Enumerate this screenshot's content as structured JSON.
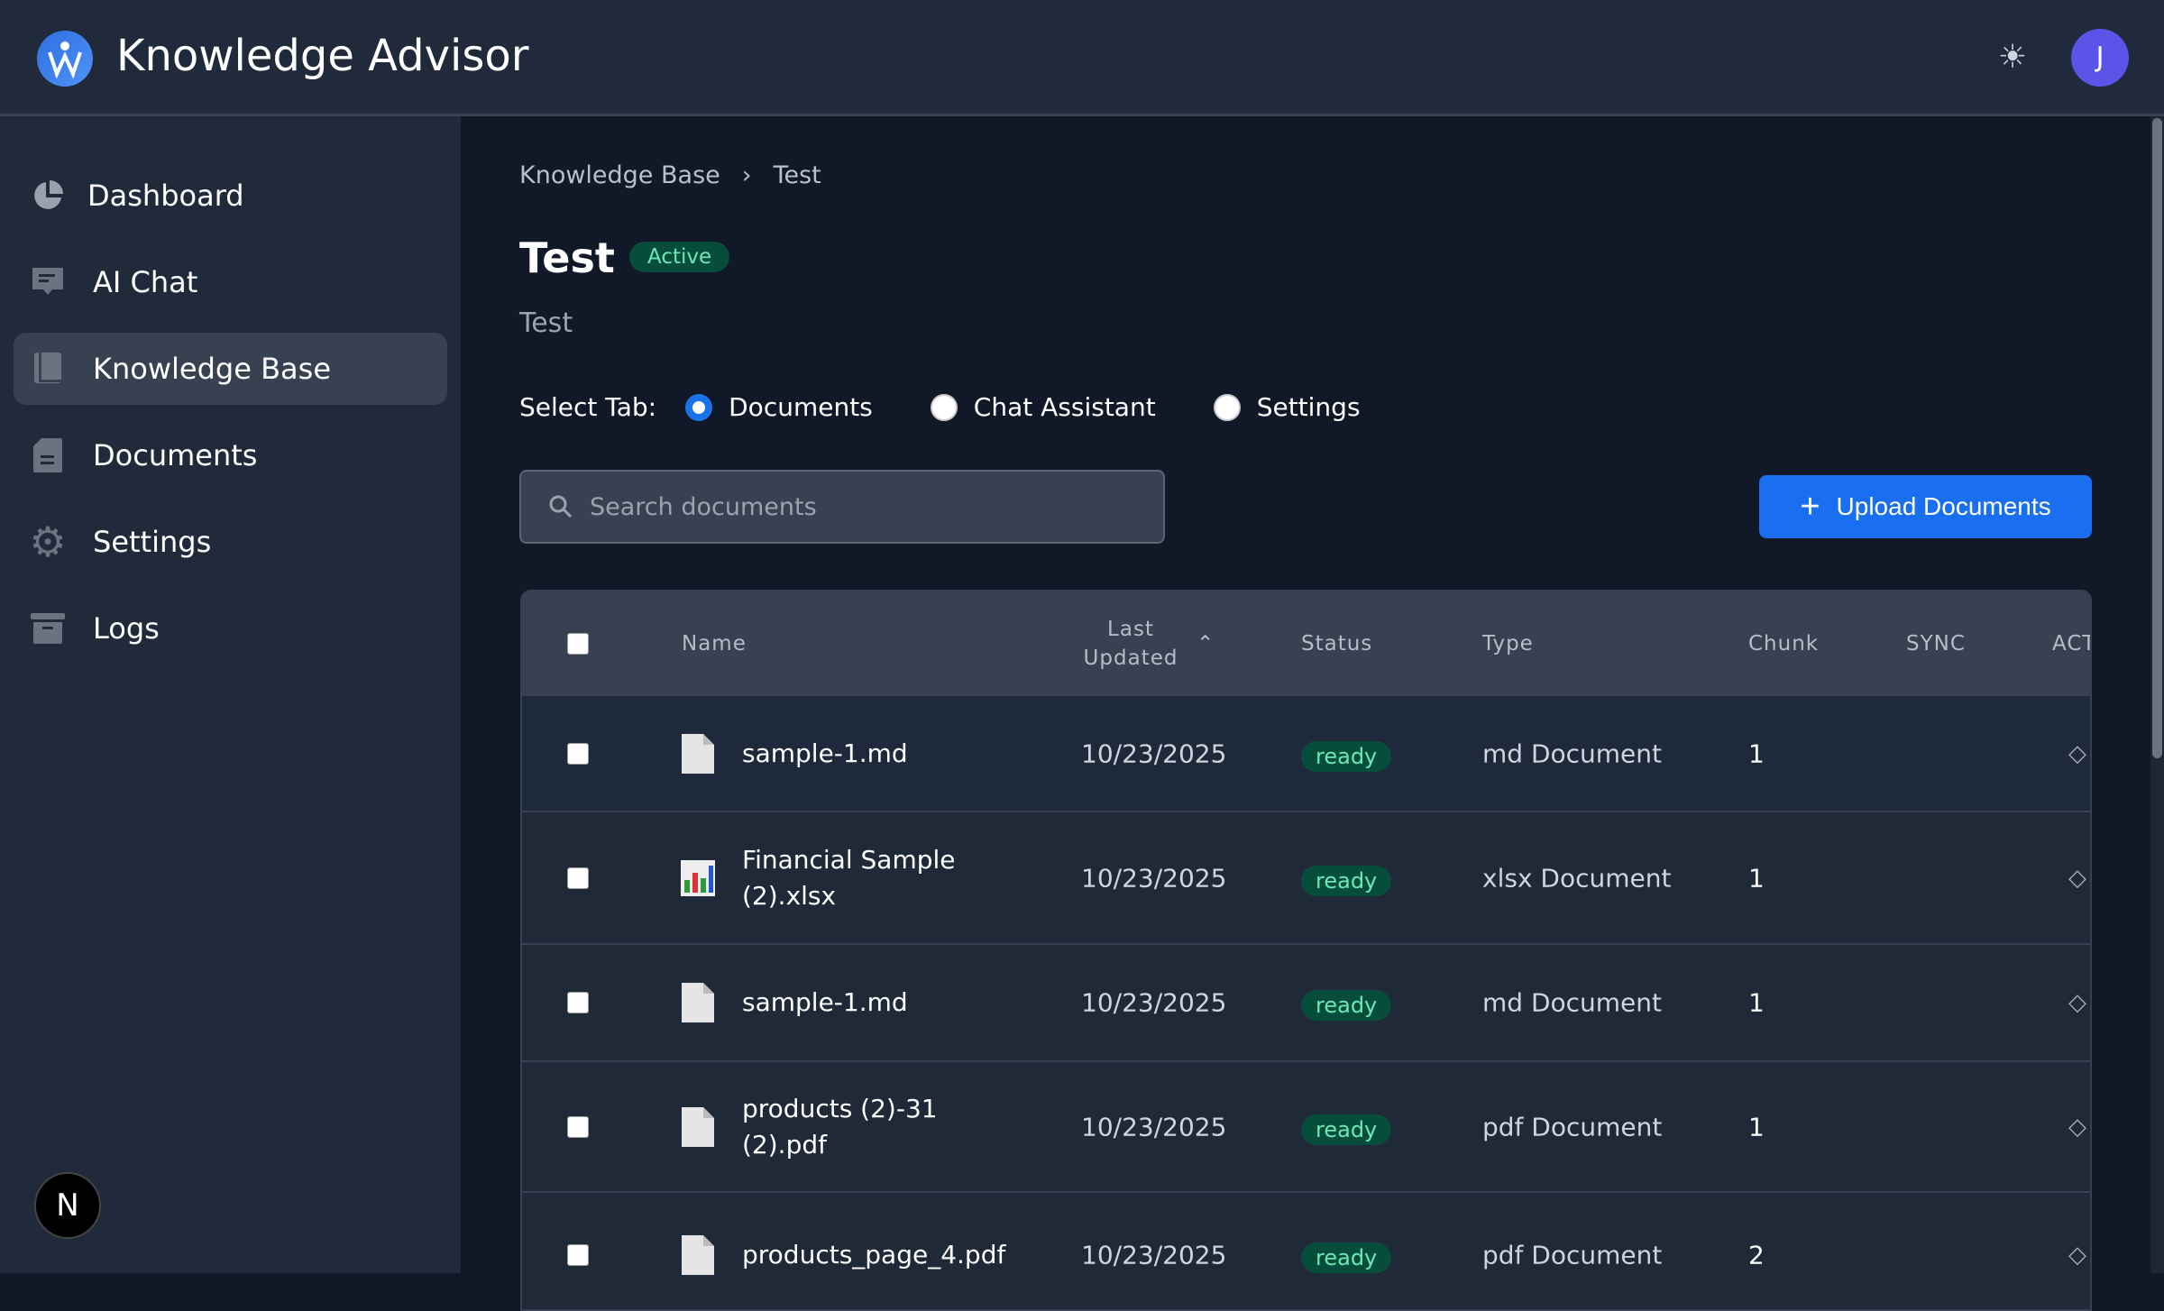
{
  "app": {
    "title": "Knowledge Advisor",
    "avatar_initial": "J",
    "next_badge": "N"
  },
  "sidebar": {
    "items": [
      {
        "label": "Dashboard",
        "icon": "pie-chart-icon"
      },
      {
        "label": "AI Chat",
        "icon": "chat-icon"
      },
      {
        "label": "Knowledge Base",
        "icon": "book-icon",
        "active": true
      },
      {
        "label": "Documents",
        "icon": "document-icon"
      },
      {
        "label": "Settings",
        "icon": "gear-icon"
      },
      {
        "label": "Logs",
        "icon": "archive-icon"
      }
    ]
  },
  "breadcrumb": [
    "Knowledge Base",
    "Test"
  ],
  "page": {
    "title": "Test",
    "status": "Active",
    "description": "Test"
  },
  "tabs": {
    "label": "Select Tab:",
    "options": [
      "Documents",
      "Chat Assistant",
      "Settings"
    ],
    "selected": "Documents"
  },
  "search": {
    "placeholder": "Search documents",
    "value": ""
  },
  "upload_label": "Upload Documents",
  "table": {
    "headers": {
      "name": "Name",
      "last_updated": "Last Updated",
      "status": "Status",
      "type": "Type",
      "chunk": "Chunk",
      "sync": "SYNC",
      "actions": "ACT"
    },
    "rows": [
      {
        "name": "sample-1.md",
        "updated": "10/23/2025",
        "status": "ready",
        "type": "md Document",
        "chunk": "1",
        "icon": "file-icon"
      },
      {
        "name": "Financial Sample (2).xlsx",
        "updated": "10/23/2025",
        "status": "ready",
        "type": "xlsx Document",
        "chunk": "1",
        "icon": "spreadsheet-icon"
      },
      {
        "name": "sample-1.md",
        "updated": "10/23/2025",
        "status": "ready",
        "type": "md Document",
        "chunk": "1",
        "icon": "file-icon"
      },
      {
        "name": "products (2)-31 (2).pdf",
        "updated": "10/23/2025",
        "status": "ready",
        "type": "pdf Document",
        "chunk": "1",
        "icon": "file-icon"
      },
      {
        "name": "products_page_4.pdf",
        "updated": "10/23/2025",
        "status": "ready",
        "type": "pdf Document",
        "chunk": "2",
        "icon": "file-icon"
      }
    ]
  },
  "colors": {
    "accent": "#1a6ff0",
    "sidebar": "#212a3a",
    "main": "#111827",
    "ready_bg": "#064e3b",
    "ready_fg": "#6ee7b7"
  }
}
